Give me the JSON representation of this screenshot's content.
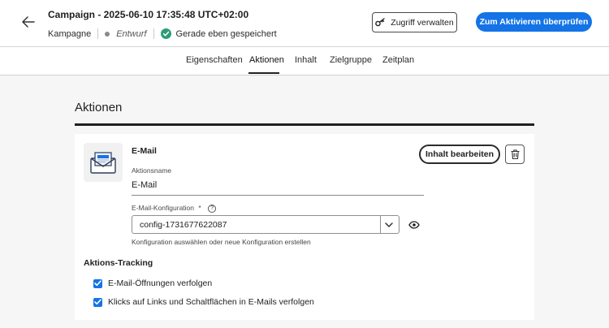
{
  "header": {
    "title": "Campaign - 2025-06-10 17:35:48 UTC+02:00",
    "type": "Kampagne",
    "status": "Entwurf",
    "saved": "Gerade eben gespeichert",
    "access_button": "Zugriff verwalten",
    "review_button": "Zum Aktivieren überprüfen"
  },
  "tabs": [
    {
      "label": "Eigenschaften",
      "active": false
    },
    {
      "label": "Aktionen",
      "active": true
    },
    {
      "label": "Inhalt",
      "active": false
    },
    {
      "label": "Zielgruppe",
      "active": false
    },
    {
      "label": "Zeitplan",
      "active": false
    }
  ],
  "section": {
    "title": "Aktionen"
  },
  "card": {
    "heading": "E-Mail",
    "edit_button": "Inhalt bearbeiten",
    "name_label": "Aktionsname",
    "name_value": "E-Mail",
    "config_label": "E-Mail-Konfiguration",
    "required_mark": "*",
    "config_value": "config-1731677622087",
    "config_help": "Konfiguration auswählen oder neue Konfiguration erstellen"
  },
  "tracking": {
    "title": "Aktions-Tracking",
    "options": [
      {
        "label": "E-Mail-Öffnungen verfolgen",
        "checked": true
      },
      {
        "label": "Klicks auf Links und Schaltflächen in E-Mails verfolgen",
        "checked": true
      }
    ]
  },
  "colors": {
    "accent": "#1473e6",
    "saved_check": "#2d9d78"
  }
}
